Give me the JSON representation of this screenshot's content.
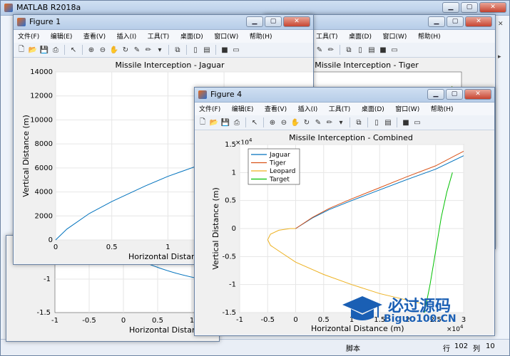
{
  "main_window": {
    "title": "MATLAB R2018a"
  },
  "status_bar": {
    "script_label": "脚本",
    "row_label": "行",
    "row_value": "102",
    "col_label": "列",
    "col_value": "10"
  },
  "menus": [
    "文件(F)",
    "编辑(E)",
    "查看(V)",
    "插入(I)",
    "工具(T)",
    "桌面(D)",
    "窗口(W)",
    "帮助(H)"
  ],
  "window_controls": {
    "minimize": "▁",
    "maximize": "▢",
    "close": "✕"
  },
  "figure1": {
    "title": "Figure 1",
    "chart_data": {
      "type": "line",
      "title": "Missile Interception - Jaguar",
      "xlabel": "Horizontal Distance",
      "ylabel": "Vertical Distance (m)",
      "xlim": [
        0,
        2.3
      ],
      "ylim": [
        0,
        14000
      ],
      "xticks": [
        "0",
        "0.5",
        "1",
        "1.5"
      ],
      "yticks": [
        "0",
        "2000",
        "4000",
        "6000",
        "8000",
        "10000",
        "12000",
        "14000"
      ],
      "grid": true,
      "series": [
        {
          "color": "#0072bd",
          "x": [
            0,
            0.1,
            0.3,
            0.5,
            0.8,
            1.0,
            1.3,
            1.6,
            1.9,
            2.3
          ],
          "y": [
            0,
            900,
            2200,
            3200,
            4500,
            5300,
            6300,
            7300,
            8200,
            9400
          ]
        }
      ]
    }
  },
  "figure2": {
    "chart_data": {
      "type": "line",
      "title": "Missile Interception - Tiger",
      "grid": true,
      "series": [
        {
          "color": "#0072bd"
        },
        {
          "color": "#77ac30"
        }
      ]
    }
  },
  "figure3_partial": {
    "chart_data": {
      "type": "line",
      "xlabel": "Horizontal Distance",
      "ylim_visible": [
        -1.5,
        -0.5
      ],
      "xticks": [
        "-1",
        "-0.5",
        "0",
        "0.5",
        "1"
      ],
      "yticks": [
        "-1",
        "-1.5"
      ],
      "grid": true
    }
  },
  "figure4": {
    "title": "Figure 4",
    "chart_data": {
      "type": "line",
      "title": "Missile Interception - Combined",
      "xlabel": "Horizontal Distance (m)",
      "ylabel": "Vertical Distance (m)",
      "x_exponent": "×10",
      "x_exponent_power": "4",
      "y_exponent": "×10",
      "y_exponent_power": "4",
      "xlim": [
        -1,
        3
      ],
      "ylim": [
        -1.5,
        1.5
      ],
      "xticks": [
        "-1",
        "-0.5",
        "0",
        "0.5",
        "1",
        "1.5",
        "2",
        "2.5",
        "3"
      ],
      "yticks": [
        "1.5",
        "1",
        "0.5",
        "0",
        "-0.5",
        "-1",
        "-1.5"
      ],
      "grid": true,
      "legend_position": "top-left",
      "series": [
        {
          "name": "Jaguar",
          "color": "#0072bd",
          "x": [
            0,
            0.3,
            0.6,
            1.0,
            1.5,
            2.0,
            2.5,
            3.0
          ],
          "y": [
            0,
            0.19,
            0.34,
            0.5,
            0.69,
            0.88,
            1.06,
            1.3
          ]
        },
        {
          "name": "Tiger",
          "color": "#d95319",
          "x": [
            0,
            0.3,
            0.6,
            1.0,
            1.5,
            2.0,
            2.5,
            3.0
          ],
          "y": [
            0,
            0.2,
            0.36,
            0.53,
            0.73,
            0.93,
            1.12,
            1.38
          ]
        },
        {
          "name": "Leopard",
          "color": "#edb120",
          "x": [
            0,
            -0.1,
            -0.3,
            -0.45,
            -0.5,
            -0.45,
            -0.3,
            0,
            0.5,
            1.0,
            1.5,
            2.0,
            2.3
          ],
          "y": [
            0,
            0.0,
            -0.03,
            -0.1,
            -0.2,
            -0.3,
            -0.4,
            -0.6,
            -0.82,
            -1.0,
            -1.16,
            -1.28,
            -1.35
          ]
        },
        {
          "name": "Target",
          "color": "#00c000",
          "x": [
            2.3,
            2.4,
            2.5,
            2.6,
            2.7,
            2.8
          ],
          "y": [
            -1.5,
            -1.0,
            -0.4,
            0.2,
            0.65,
            1.0
          ]
        }
      ]
    }
  },
  "watermark": {
    "brand": "必过源码",
    "url": "Biguo100.CN"
  }
}
